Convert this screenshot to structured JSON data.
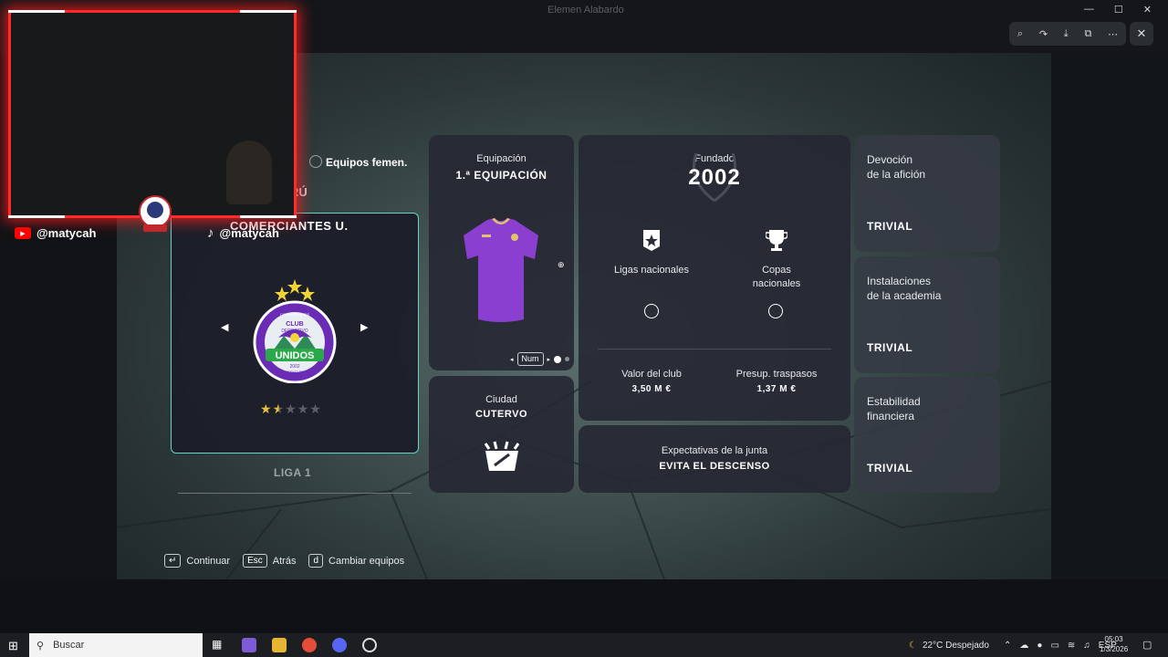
{
  "viewer": {
    "title": "Elemen Alabardo"
  },
  "overlay": {
    "tiktok_handle": "@matycah",
    "youtube_handle": "@matycah"
  },
  "team_select": {
    "womens_teams_label": "Equipos femen.",
    "country_fragment": "RÚ",
    "club_name": "COMERCIANTES U.",
    "league": "LIGA 1",
    "rating_stars": 1.5,
    "rating_max": 5,
    "badge": {
      "top": "CLUB",
      "mid": "DEPORTIVO",
      "main": "UNIDOS",
      "ring": "COMERCIANTES",
      "year": "2002",
      "city": "CUTERVO PERÚ"
    }
  },
  "kit": {
    "label": "Equipación",
    "value": "1.ª EQUIPACIÓN",
    "nav_key": "Num",
    "kit_color": "#8a3fd0"
  },
  "city": {
    "label": "Ciudad",
    "value": "CUTERVO"
  },
  "club_info": {
    "founded_label": "Fundado",
    "founded_value": "2002",
    "leagues_label": "Ligas nacionales",
    "cups_label_1": "Copas",
    "cups_label_2": "nacionales",
    "club_value_label": "Valor del club",
    "club_value": "3,50 M €",
    "transfer_budget_label": "Presup. traspasos",
    "transfer_budget": "1,37 M €",
    "board_label": "Expectativas de la junta",
    "board_value": "EVITA EL DESCENSO"
  },
  "ratings": [
    {
      "line1": "Devoción",
      "line2": "de la afición",
      "value": "TRIVIAL"
    },
    {
      "line1": "Instalaciones",
      "line2": "de la academia",
      "value": "TRIVIAL"
    },
    {
      "line1": "Estabilidad",
      "line2": "financiera",
      "value": "TRIVIAL"
    }
  ],
  "footer": {
    "continue_key": "↵",
    "continue_label": "Continuar",
    "back_key": "Esc",
    "back_label": "Atrás",
    "change_key": "d",
    "change_label": "Cambiar equipos"
  },
  "taskbar": {
    "search_placeholder": "Buscar",
    "weather": "22°C  Despejado",
    "language": "ESP",
    "time": "05:03",
    "date": "1/3/2026"
  },
  "colors": {
    "accent_teal": "#66d6c8",
    "webcam_red": "#ff2a2a",
    "star_gold": "#e8c33a"
  }
}
